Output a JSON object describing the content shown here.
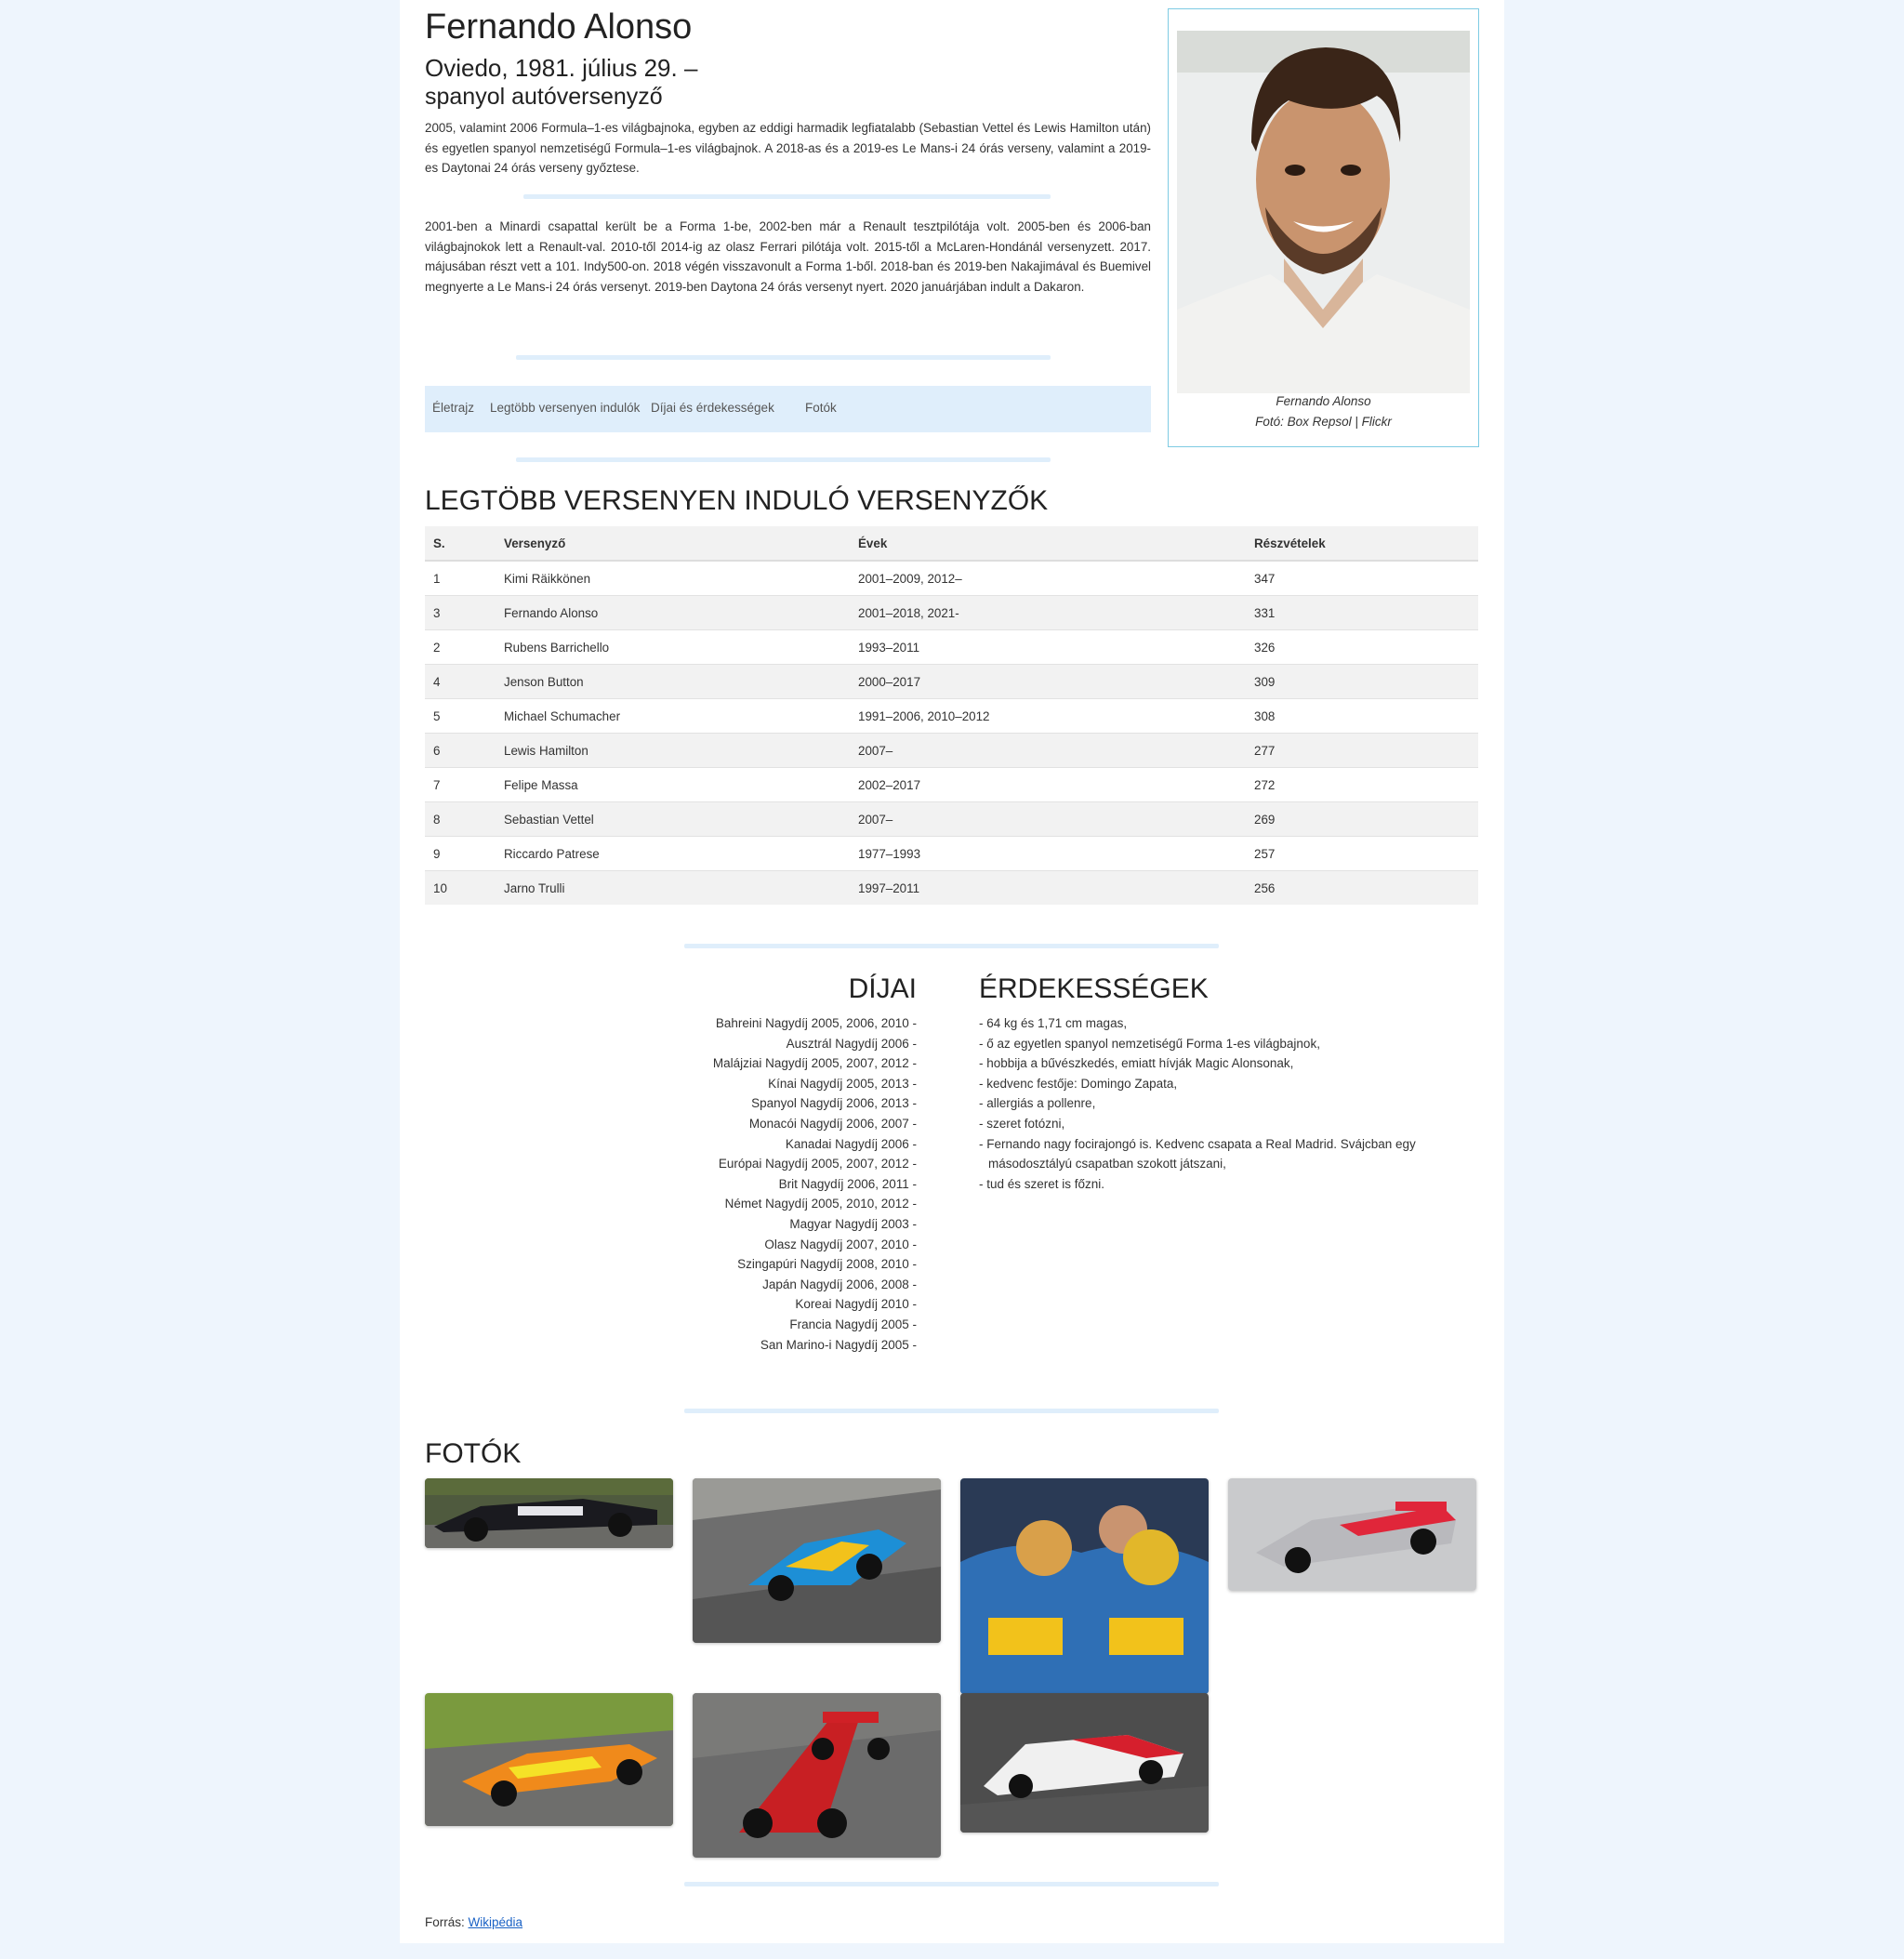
{
  "profile": {
    "name": "Fernando Alonso",
    "birth": "Oviedo, 1981. július 29. –",
    "occupation": "spanyol autóversenyző",
    "intro": "2005, valamint 2006 Formula–1-es világbajnoka, egyben az eddigi harmadik legfiatalabb (Sebastian Vettel és Lewis Hamilton után) és egyetlen spanyol nemzetiségű Formula–1-es világbajnok. A 2018-as és a 2019-es Le Mans-i 24 órás verseny, valamint a 2019-es Daytonai 24 órás verseny győztese.",
    "bio": "2001-ben a Minardi csapattal került be a Forma 1-be, 2002-ben már a Renault tesztpilótája volt. 2005-ben és 2006-ban világbajnokok lett a Renault-val. 2010-től 2014-ig az olasz Ferrari pilótája volt. 2015-től a McLaren-Hondánál versenyzett. 2017. májusában részt vett a 101. Indy500-on. 2018 végén visszavonult a Forma 1-ből. 2018-ban és 2019-ben Nakajimával és Buemivel megnyerte a Le Mans-i 24 órás versenyt. 2019-ben Daytona 24 órás versenyt nyert. 2020 januárjában indult a Dakaron.",
    "photo_caption": "Fernando Alonso",
    "photo_credit": "Fotó: Box Repsol | Flickr"
  },
  "nav": {
    "items": [
      "Életrajz",
      "Legtöbb versenyen indulók",
      "Díjai és érdekességek",
      "Fotók"
    ]
  },
  "ranking": {
    "title": "LEGTÖBB VERSENYEN INDULÓ VERSENYZŐK",
    "headers": [
      "S.",
      "Versenyző",
      "Évek",
      "Részvételek"
    ],
    "rows": [
      [
        "1",
        "Kimi Räikkönen",
        "2001–2009, 2012–",
        "347"
      ],
      [
        "3",
        "Fernando Alonso",
        "2001–2018, 2021-",
        "331"
      ],
      [
        "2",
        "Rubens Barrichello",
        "1993–2011",
        "326"
      ],
      [
        "4",
        "Jenson Button",
        "2000–2017",
        "309"
      ],
      [
        "5",
        "Michael Schumacher",
        "1991–2006, 2010–2012",
        "308"
      ],
      [
        "6",
        "Lewis Hamilton",
        "2007–",
        "277"
      ],
      [
        "7",
        "Felipe Massa",
        "2002–2017",
        "272"
      ],
      [
        "8",
        "Sebastian Vettel",
        "2007–",
        "269"
      ],
      [
        "9",
        "Riccardo Patrese",
        "1977–1993",
        "257"
      ],
      [
        "10",
        "Jarno Trulli",
        "1997–2011",
        "256"
      ]
    ]
  },
  "awards": {
    "title": "DÍJAI",
    "items": [
      "Bahreini Nagydíj 2005, 2006, 2010 -",
      "Ausztrál Nagydíj 2006 -",
      "Malájziai Nagydíj 2005, 2007, 2012 -",
      "Kínai Nagydíj 2005, 2013 -",
      "Spanyol Nagydíj 2006, 2013 -",
      "Monacói Nagydíj 2006, 2007 -",
      "Kanadai Nagydíj 2006 -",
      "Európai Nagydíj 2005, 2007, 2012 -",
      "Brit Nagydíj 2006, 2011 -",
      "Német Nagydíj 2005, 2010, 2012 -",
      "Magyar Nagydíj 2003 -",
      "Olasz Nagydíj 2007, 2010 -",
      "Szingapúri Nagydíj 2008, 2010 -",
      "Japán Nagydíj 2006, 2008 -",
      "Koreai Nagydíj 2010 -",
      "Francia Nagydíj 2005 -",
      "San Marino-i Nagydíj 2005 -"
    ]
  },
  "facts": {
    "title": "ÉRDEKESSÉGEK",
    "items": [
      "- 64 kg és 1,71 cm magas,",
      "- ő az egyetlen spanyol nemzetiségű Forma 1-es világbajnok,",
      "- hobbija a bűvészkedés, emiatt hívják Magic Alonsonak,",
      "- kedvenc festője: Domingo Zapata,",
      "- allergiás a pollenre,",
      "- szeret fotózni,",
      "- Fernando nagy focirajongó is. Kedvenc csapata a Real Madrid. Svájcban egy másodosztályú csapatban szokott játszani,",
      "- tud és szeret is főzni."
    ]
  },
  "photos": {
    "title": "FOTÓK"
  },
  "footer": {
    "label": "Forrás:",
    "link": "Wikipédia"
  }
}
